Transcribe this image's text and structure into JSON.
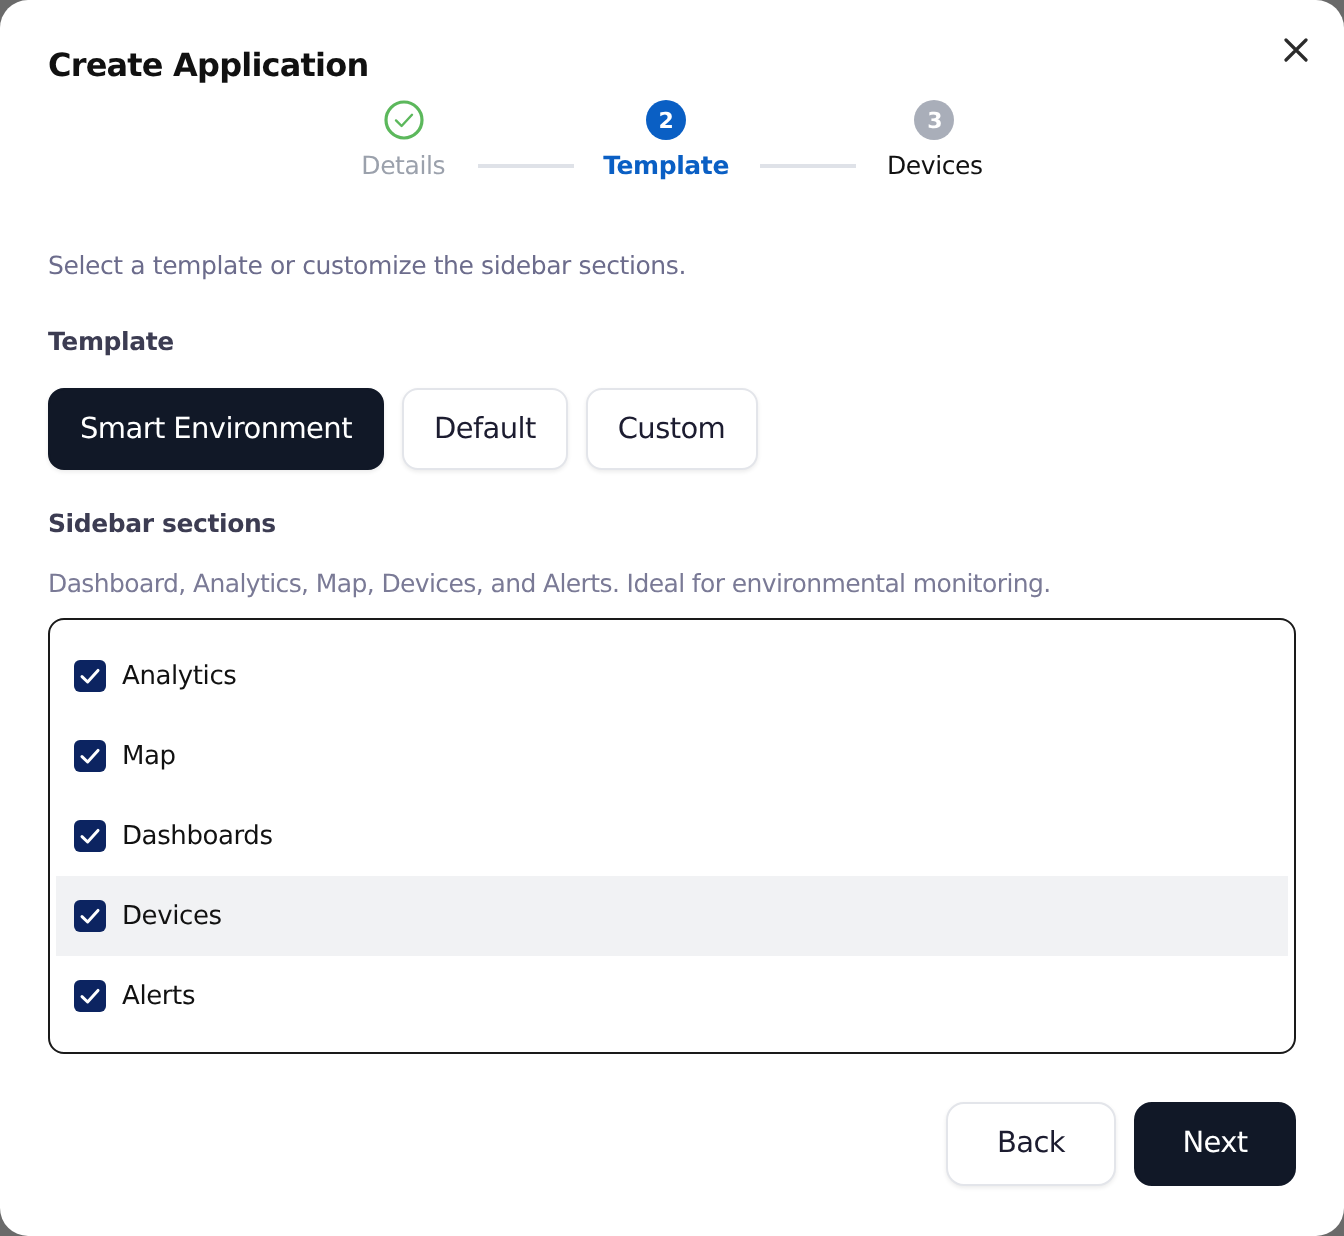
{
  "dialog": {
    "title": "Create Application"
  },
  "steps": [
    {
      "label": "Details",
      "completed": true,
      "selected": false
    },
    {
      "label": "Template",
      "completed": false,
      "selected": true,
      "number": "2"
    },
    {
      "label": "Devices",
      "completed": false,
      "selected": false,
      "number": "3"
    }
  ],
  "intro": "Select a template or customize the sidebar sections.",
  "template_label": "Template",
  "templates": [
    {
      "label": "Smart Environment",
      "selected": true
    },
    {
      "label": "Default",
      "selected": false
    },
    {
      "label": "Custom",
      "selected": false
    }
  ],
  "sections_label": "Sidebar sections",
  "sections_hint": "Dashboard, Analytics, Map, Devices, and Alerts. Ideal for environmental monitoring.",
  "sections": [
    {
      "label": "Analytics",
      "checked": true,
      "hovered": false
    },
    {
      "label": "Map",
      "checked": true,
      "hovered": false
    },
    {
      "label": "Dashboards",
      "checked": true,
      "hovered": false
    },
    {
      "label": "Devices",
      "checked": true,
      "hovered": true
    },
    {
      "label": "Alerts",
      "checked": true,
      "hovered": false
    }
  ],
  "buttons": [
    {
      "label": "Back",
      "kind": "secondary"
    },
    {
      "label": "Next",
      "kind": "primary"
    }
  ]
}
